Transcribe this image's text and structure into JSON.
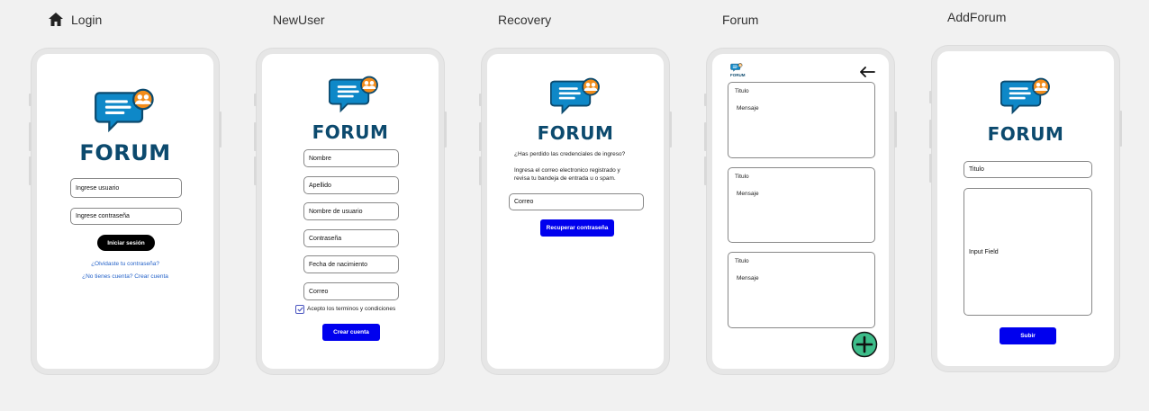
{
  "frames": {
    "login": "Login",
    "newuser": "NewUser",
    "recovery": "Recovery",
    "forum": "Forum",
    "addforum": "AddForum"
  },
  "logo_text": "FORUM",
  "mini_logo_text": "FORUM",
  "login": {
    "user_placeholder": "Ingrese usuario",
    "password_placeholder": "Ingrese contraseña",
    "login_button": "Iniciar sesión",
    "forgot_link": "¿Olvidaste tu contraseña?",
    "register_link": "¿No tienes cuenta? Crear cuenta"
  },
  "newuser": {
    "fields": [
      "Nombre",
      "Apellido",
      "Nombre de usuario",
      "Contraseña",
      "Fecha de nacimiento",
      "Correo"
    ],
    "terms_label": "Acepto los terminos y condiciones",
    "terms_checked": true,
    "create_button": "Crear cuenta"
  },
  "recovery": {
    "question": "¿Has perdido las credenciales de ingreso?",
    "instructions_line1": "Ingresa el correo electronico registrado y",
    "instructions_line2": "revisa tu bandeja de entrada u o spam.",
    "email_field": "Correo",
    "recover_button": "Recuperar contraseña"
  },
  "forum": {
    "back_icon": "arrow-left-icon",
    "add_icon": "plus-circle-icon",
    "posts": [
      {
        "title": "Titulo",
        "message": "Mensaje"
      },
      {
        "title": "Titulo",
        "message": "Mensaje"
      },
      {
        "title": "Titulo",
        "message": "Mensaje"
      }
    ]
  },
  "addforum": {
    "title_field": "Titulo",
    "input_field": "Input Field",
    "submit_button": "Subir"
  },
  "colors": {
    "primary_button": "#0000ee",
    "dark_button": "#000000",
    "link": "#2563c9",
    "logo_text": "#0c4a6e",
    "logo_bubble": "#0e88c8",
    "logo_accent": "#f28c1a",
    "add_button": "#3dbd8a"
  }
}
